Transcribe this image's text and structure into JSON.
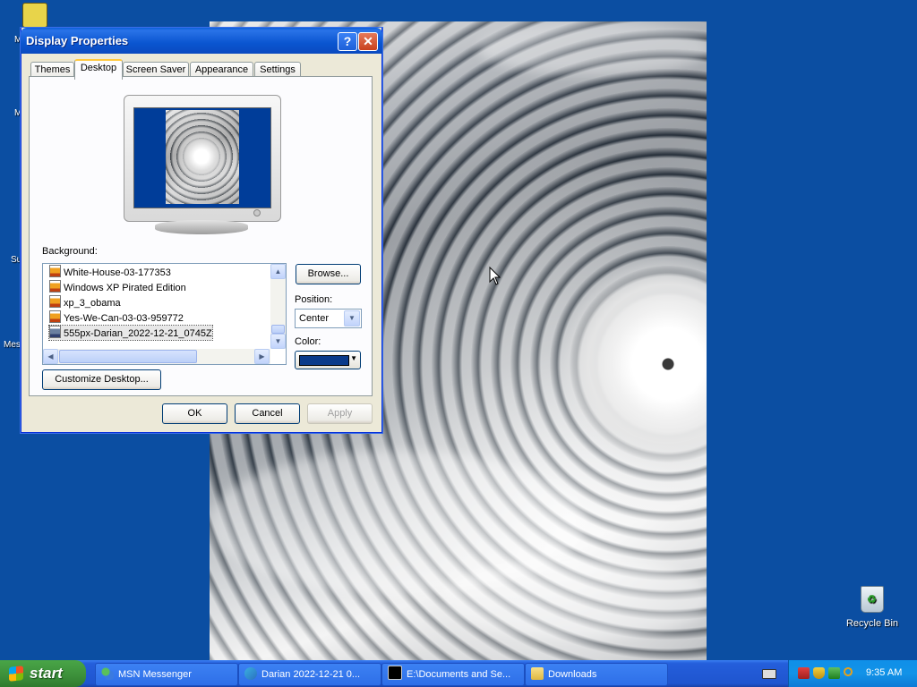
{
  "desktop": {
    "icons": [
      {
        "label": "Recycle Bin"
      }
    ],
    "edge_labels": [
      "M",
      "M",
      "Su",
      "Mes"
    ]
  },
  "dialog": {
    "title": "Display Properties",
    "help_glyph": "?",
    "close_glyph": "✕",
    "tabs": [
      {
        "label": "Themes",
        "active": false
      },
      {
        "label": "Desktop",
        "active": true
      },
      {
        "label": "Screen Saver",
        "active": false
      },
      {
        "label": "Appearance",
        "active": false
      },
      {
        "label": "Settings",
        "active": false
      }
    ],
    "background_label": "Background:",
    "background_items": [
      {
        "label": "White-House-03-177353",
        "selected": false
      },
      {
        "label": "Windows XP Pirated Edition",
        "selected": false
      },
      {
        "label": "xp_3_obama",
        "selected": false
      },
      {
        "label": "Yes-We-Can-03-03-959772",
        "selected": false
      },
      {
        "label": "555px-Darian_2022-12-21_0745Z",
        "selected": true
      }
    ],
    "browse_label": "Browse...",
    "position_label": "Position:",
    "position_value": "Center",
    "color_label": "Color:",
    "color_value": "#0a3a8a",
    "customize_label": "Customize Desktop...",
    "ok_label": "OK",
    "cancel_label": "Cancel",
    "apply_label": "Apply"
  },
  "taskbar": {
    "start_label": "start",
    "items": [
      {
        "label": "MSN Messenger",
        "icon": "msn-messenger-icon"
      },
      {
        "label": "Darian 2022-12-21 0...",
        "icon": "image-viewer-icon"
      },
      {
        "label": "E:\\Documents and Se...",
        "icon": "command-prompt-icon"
      },
      {
        "label": "Downloads",
        "icon": "folder-icon"
      }
    ],
    "clock": "9:35 AM"
  }
}
